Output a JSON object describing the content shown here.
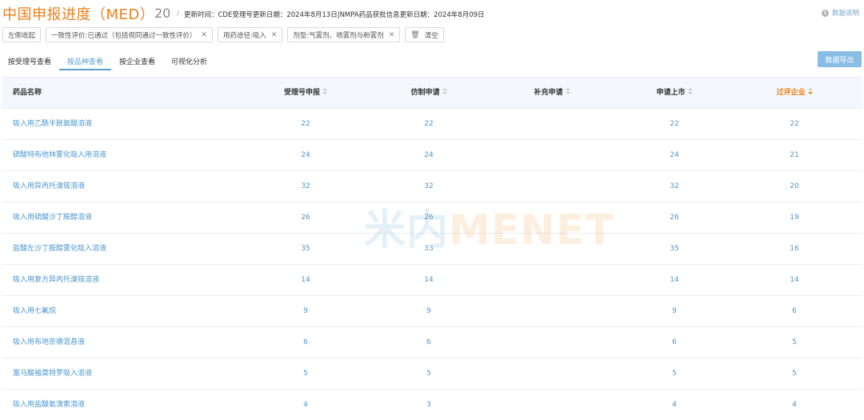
{
  "header": {
    "title": "中国申报进度（MED）",
    "count": "20",
    "separator": "/",
    "update_info": "更新时间：CDE受理号更新日期：2024年8月13日|NMPA药品获批信息更新日期：2024年8月09日",
    "help_label": "数据说明",
    "help_icon": "info-icon"
  },
  "filters": {
    "collapse_label": "左侧收起",
    "chips": [
      "一致性评价:已通过（包括视同通过一致性评价）",
      "用药途径:吸入",
      "剂型:气雾剂、喷雾剂与粉雾剂"
    ],
    "clear_label": "清空"
  },
  "tabs": [
    "按受理号查看",
    "按品种查看",
    "按企业查看",
    "可视化分析"
  ],
  "active_tab": 1,
  "export_label": "数据导出",
  "table": {
    "headers": [
      "药品名称",
      "受理号申报",
      "仿制申请",
      "补充申请",
      "申请上市",
      "过评企业"
    ],
    "sorted_column": 5,
    "rows": [
      [
        "吸入用乙酰半胱氨酸溶液",
        "22",
        "22",
        "",
        "22",
        "22"
      ],
      [
        "硫酸特布他林雾化吸入用溶液",
        "24",
        "24",
        "",
        "24",
        "21"
      ],
      [
        "吸入用异丙托溴铵溶液",
        "32",
        "32",
        "",
        "32",
        "20"
      ],
      [
        "吸入用硫酸沙丁胺醇溶液",
        "26",
        "26",
        "",
        "26",
        "19"
      ],
      [
        "盐酸左沙丁胺醇雾化吸入溶液",
        "35",
        "33",
        "",
        "35",
        "16"
      ],
      [
        "吸入用复方异丙托溴铵溶液",
        "14",
        "14",
        "",
        "14",
        "14"
      ],
      [
        "吸入用七氟烷",
        "9",
        "9",
        "",
        "9",
        "6"
      ],
      [
        "吸入用布地奈德混悬液",
        "6",
        "6",
        "",
        "6",
        "5"
      ],
      [
        "富马酸福莫特罗吸入溶液",
        "5",
        "5",
        "",
        "5",
        "5"
      ],
      [
        "吸入用盐酸氨溴索溶液",
        "4",
        "3",
        "",
        "4",
        "4"
      ]
    ]
  },
  "watermark": {
    "cn": "米内",
    "en": "MENET"
  },
  "colors": {
    "accent": "#e8821e",
    "link": "#4d97cc",
    "button": "#88bde6"
  }
}
